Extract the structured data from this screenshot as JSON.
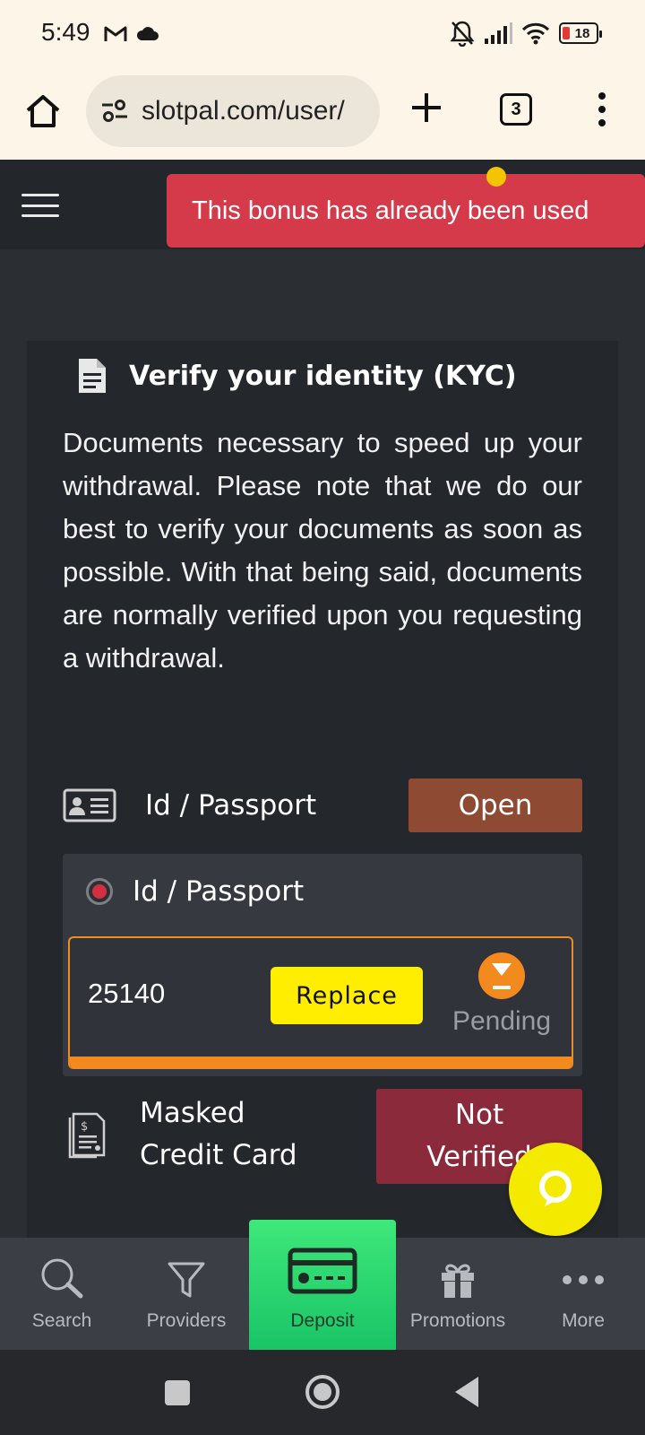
{
  "status_bar": {
    "time": "5:49",
    "battery_level": "18",
    "icons": [
      "gmail-icon",
      "cloud-icon",
      "bell-off-icon",
      "signal-icon",
      "wifi-icon",
      "battery-icon"
    ]
  },
  "browser": {
    "url": "slotpal.com/user/",
    "tab_count": "3",
    "icons": [
      "home-icon",
      "site-settings-icon",
      "new-tab-icon",
      "tab-switcher-icon",
      "menu-icon"
    ]
  },
  "site_header": {
    "toast_message": "This bonus has already been used",
    "icons": [
      "hamburger-menu-icon",
      "logo-icon"
    ]
  },
  "kyc": {
    "title": "Verify your identity (KYC)",
    "description": "Documents necessary to speed up your withdrawal. Please note that we do our best to verify your documents as soon as possible. With that being said, documents are normally verified upon you requesting a withdrawal.",
    "id_section": {
      "label": "Id / Passport",
      "button_label": "Open",
      "panel_title": "Id / Passport",
      "document": {
        "number": "25140",
        "replace_label": "Replace",
        "status": "Pending"
      }
    },
    "credit_card_section": {
      "label_line1": "Masked",
      "label_line2": "Credit Card",
      "status_line1": "Not",
      "status_line2": "Verified"
    }
  },
  "bottom_nav": {
    "items": [
      {
        "label": "Search",
        "icon": "search-icon"
      },
      {
        "label": "Providers",
        "icon": "filter-icon"
      },
      {
        "label": "Deposit",
        "icon": "credit-card-icon"
      },
      {
        "label": "Promotions",
        "icon": "gift-icon"
      },
      {
        "label": "More",
        "icon": "more-dots-icon"
      }
    ]
  },
  "colors": {
    "toast": "#d53a4a",
    "open_button": "#8e4a33",
    "replace_button": "#ffee00",
    "pending": "#f28a1e",
    "not_verified": "#8a2a3a",
    "deposit_nav": "#19c466",
    "chat_fab": "#f4ea00"
  }
}
